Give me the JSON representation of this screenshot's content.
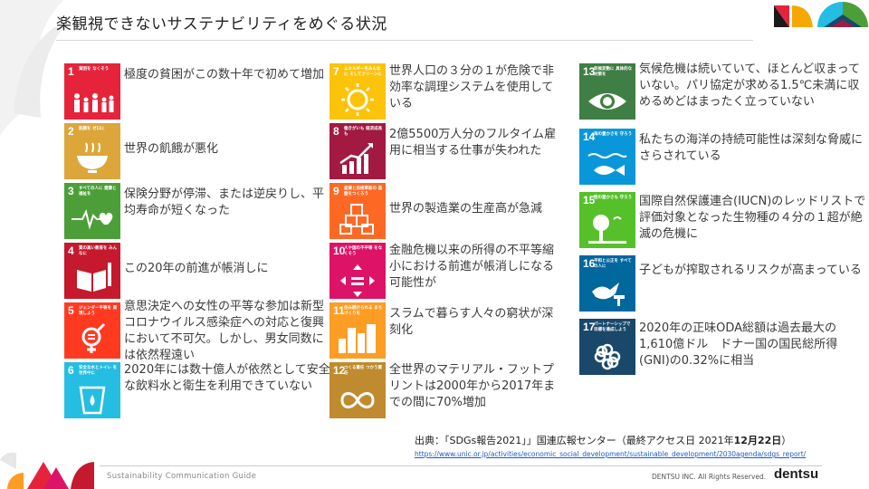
{
  "title": "楽観視できないサステナビリティをめぐる状況",
  "columns": [
    [
      {
        "num": "1",
        "cap": "貧困を なくそう",
        "color": "#e5243b",
        "icon": "people-family-icon",
        "text": "極度の貧困がこの数十年で初めて増加"
      },
      {
        "num": "2",
        "cap": "飢餓を ゼロに",
        "color": "#dda63a",
        "icon": "food-bowl-icon",
        "text": "世界の飢餓が悪化"
      },
      {
        "num": "3",
        "cap": "すべての人に 健康と福祉を",
        "color": "#4c9f38",
        "icon": "heartbeat-icon",
        "text": "保険分野が停滞、または逆戻りし、平均寿命が短くなった"
      },
      {
        "num": "4",
        "cap": "質の高い教育を みんなに",
        "color": "#c5192d",
        "icon": "book-pencil-icon",
        "text": "この20年の前進が帳消しに"
      },
      {
        "num": "5",
        "cap": "ジェンダー平等を 実現しよう",
        "color": "#ff3a21",
        "icon": "gender-equality-icon",
        "text": "意思決定への女性の平等な参加は新型コロナウイルス感染症への対応と復興において不可欠。しかし、男女同数には依然程遠い"
      },
      {
        "num": "6",
        "cap": "安全な水とトイレ を世界中に",
        "color": "#26bde2",
        "icon": "water-glass-icon",
        "text": "2020年には数十億人が依然として安全な飲料水と衛生を利用できていない"
      }
    ],
    [
      {
        "num": "7",
        "cap": "エネルギーをみんなに そしてクリーンに",
        "color": "#fcc30b",
        "icon": "sun-power-icon",
        "text": "世界人口の３分の１が危険で非効率な調理システムを使用している"
      },
      {
        "num": "8",
        "cap": "働きがいも 経済成長も",
        "color": "#a21942",
        "icon": "growth-chart-icon",
        "text": "2億5500万人分のフルタイム雇用に相当する仕事が失われた"
      },
      {
        "num": "9",
        "cap": "産業と技術革新の 基盤をつくろう",
        "color": "#fd6925",
        "icon": "cubes-icon",
        "text": "世界の製造業の生産高が急減"
      },
      {
        "num": "10",
        "cap": "人や国の不平等 をなくそう",
        "color": "#dd1367",
        "icon": "equality-arrows-icon",
        "text": "金融危機以来の所得の不平等縮小における前進が帳消しになる可能性が"
      },
      {
        "num": "11",
        "cap": "住み続けられる まちづくりを",
        "color": "#fd9d24",
        "icon": "city-buildings-icon",
        "text": "スラムで暮らす人々の窮状が深刻化"
      },
      {
        "num": "12",
        "cap": "つくる責任 つかう責任",
        "color": "#bf8b2e",
        "icon": "infinity-loop-icon",
        "text": "全世界のマテリアル・フットプリントは2000年から2017年までの間に70%増加"
      }
    ],
    [
      {
        "num": "13",
        "cap": "気候変動に 具体的な対策を",
        "color": "#3f7e44",
        "icon": "earth-eye-icon",
        "text": "気候危機は続いていて、ほとんど収まっていない。パリ協定が求める1.5℃未満に収めるめどはまったく立っていない"
      },
      {
        "num": "14",
        "cap": "海の豊かさを 守ろう",
        "color": "#0a97d9",
        "icon": "fish-waves-icon",
        "text": "私たちの海洋の持続可能性は深刻な脅威にさらされている"
      },
      {
        "num": "15",
        "cap": "陸の豊かさも 守ろう",
        "color": "#56c02b",
        "icon": "tree-bird-icon",
        "text": "国際自然保護連合(IUCN)のレッドリストで評価対象となった生物種の４分の１超が絶滅の危機に"
      },
      {
        "num": "16",
        "cap": "平和と公正を すべての人に",
        "color": "#00689d",
        "icon": "dove-gavel-icon",
        "text": "子どもが搾取されるリスクが高まっている"
      },
      {
        "num": "17",
        "cap": "パートナーシップで 目標を達成しよう",
        "color": "#19486a",
        "icon": "partnership-flower-icon",
        "text": "2020年の正味ODA総額は過去最大の1,610億ドル　ドナー国の国民総所得(GNI)の0.32%に相当"
      }
    ]
  ],
  "source": {
    "label": "出典：「SDGs報告2021」」国連広報センター（最終アクセス日 2021年",
    "date_bold": "12月22日",
    "close": "）",
    "url": "https://www.unic.or.jp/activities/economic_social_development/sustainable_development/2030agenda/sdgs_report/"
  },
  "footer": {
    "guide": "Sustainability Communication Guide",
    "rights": "DENTSU INC. All Rights Reserved.",
    "brand": "dentsu"
  }
}
